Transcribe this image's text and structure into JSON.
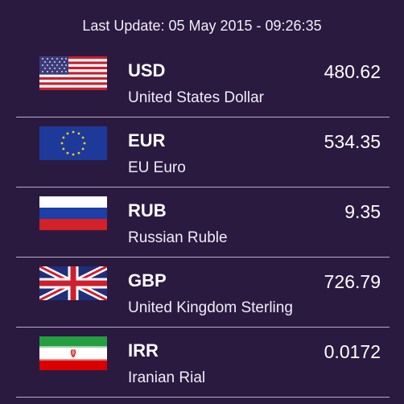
{
  "header": {
    "last_update": "Last Update: 05 May 2015 - 09:26:35"
  },
  "colors": {
    "background": "#2a1a40",
    "divider": "#cfc8da",
    "text": "#ffffff"
  },
  "currencies": [
    {
      "code": "USD",
      "name": "United States Dollar",
      "rate": "480.62",
      "flag": "us-flag-icon"
    },
    {
      "code": "EUR",
      "name": "EU Euro",
      "rate": "534.35",
      "flag": "eu-flag-icon"
    },
    {
      "code": "RUB",
      "name": "Russian Ruble",
      "rate": "9.35",
      "flag": "russia-flag-icon"
    },
    {
      "code": "GBP",
      "name": "United Kingdom Sterling",
      "rate": "726.79",
      "flag": "uk-flag-icon"
    },
    {
      "code": "IRR",
      "name": "Iranian Rial",
      "rate": "0.0172",
      "flag": "iran-flag-icon"
    }
  ]
}
